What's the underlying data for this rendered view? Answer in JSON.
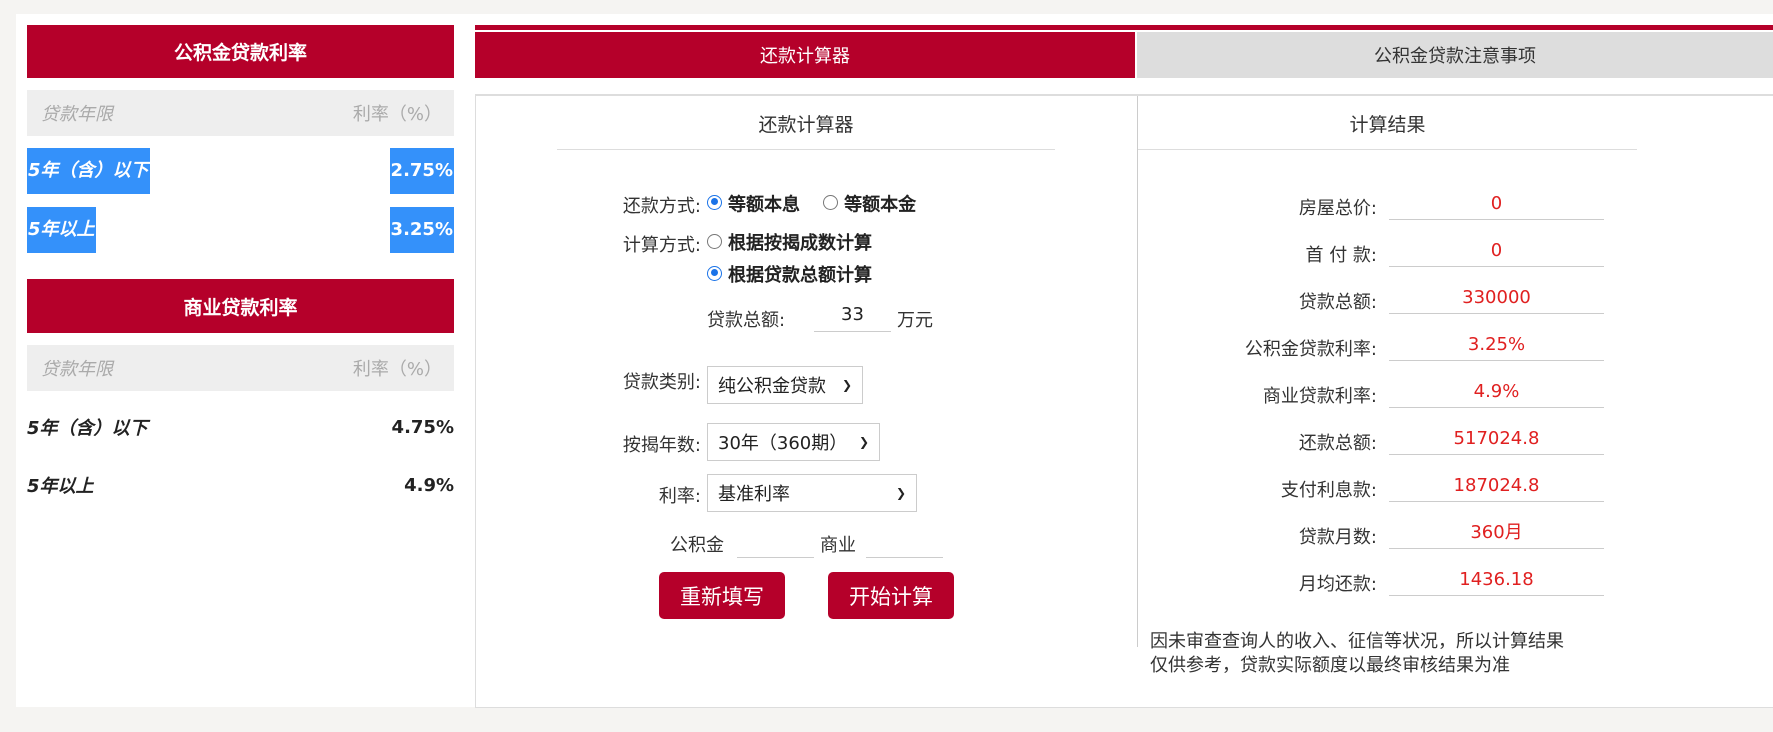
{
  "sidebar": {
    "gjj": {
      "title": "公积金贷款利率",
      "col_term": "贷款年限",
      "col_rate": "利率（%）",
      "rows": [
        {
          "term": "5年（含）以下",
          "rate": "2.75%"
        },
        {
          "term": "5年以上",
          "rate": "3.25%"
        }
      ]
    },
    "commercial": {
      "title": "商业贷款利率",
      "col_term": "贷款年限",
      "col_rate": "利率（%）",
      "rows": [
        {
          "term": "5年（含）以下",
          "rate": "4.75%"
        },
        {
          "term": "5年以上",
          "rate": "4.9%"
        }
      ]
    }
  },
  "tabs": [
    {
      "label": "还款计算器",
      "active": true
    },
    {
      "label": "公积金贷款注意事项",
      "active": false
    }
  ],
  "calculator": {
    "title": "还款计算器",
    "repay_method_label": "还款方式:",
    "repay_options": [
      "等额本息",
      "等额本金"
    ],
    "calc_method_label": "计算方式:",
    "calc_options": [
      "根据按揭成数计算",
      "根据贷款总额计算"
    ],
    "loan_total_label": "贷款总额:",
    "loan_total_value": "33",
    "loan_total_unit": "万元",
    "loan_type_label": "贷款类别:",
    "loan_type_value": "纯公积金贷款",
    "years_label": "按揭年数:",
    "years_value": "30年（360期）",
    "rate_label": "利率:",
    "rate_value": "基准利率",
    "gjj_label": "公积金",
    "commercial_label": "商业",
    "reset_button": "重新填写",
    "calc_button": "开始计算"
  },
  "results": {
    "title": "计算结果",
    "rows": [
      {
        "label": "房屋总价:",
        "value": "0"
      },
      {
        "label": "首 付 款:",
        "value": "0"
      },
      {
        "label": "贷款总额:",
        "value": "330000"
      },
      {
        "label": "公积金贷款利率:",
        "value": "3.25%"
      },
      {
        "label": "商业贷款利率:",
        "value": "4.9%"
      },
      {
        "label": "还款总额:",
        "value": "517024.8"
      },
      {
        "label": "支付利息款:",
        "value": "187024.8"
      },
      {
        "label": "贷款月数:",
        "value": "360月"
      },
      {
        "label": "月均还款:",
        "value": "1436.18"
      }
    ],
    "note_line1": "因未审查查询人的收入、征信等状况，所以计算结果",
    "note_line2": "仅供参考，贷款实际额度以最终审核结果为准"
  }
}
